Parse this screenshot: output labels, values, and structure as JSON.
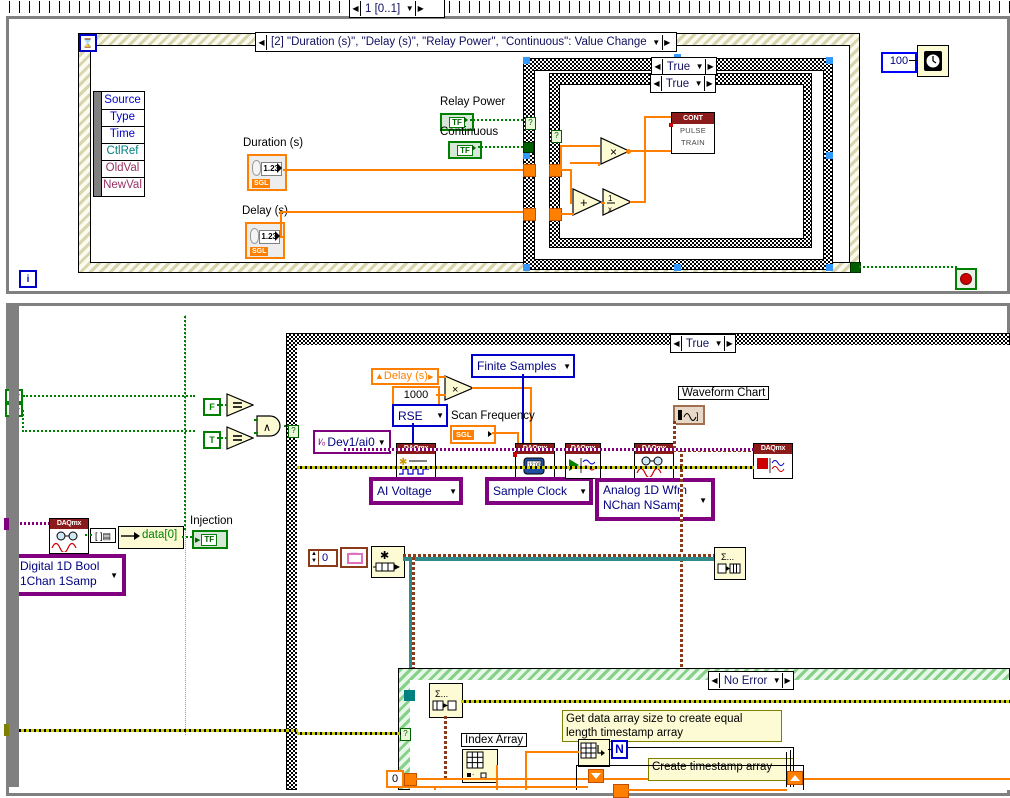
{
  "app": {
    "type": "labview-block-diagram",
    "colors": {
      "wire_orange": "#ff7f00",
      "wire_green": "#008000",
      "wire_purple": "#800080",
      "wire_yellow": "#cccc00",
      "wire_brown": "#8b3a1a",
      "daqmx_header": "#8b1a1a",
      "structure_yellow": "#d8d4ae",
      "structure_green": "#86d08a"
    }
  },
  "upper": {
    "frame_selector": {
      "label": "1 [0..1]",
      "left_arrow": "◀",
      "right_arrow": "▶",
      "down_arrow": "▼"
    },
    "event_structure": {
      "case_label": "[2] \"Duration (s)\", \"Delay (s)\", \"Relay Power\", \"Continuous\": Value Change",
      "timeout_icon": "hourglass-icon",
      "iteration_icon": "i",
      "event_data_node": {
        "rows": [
          "Source",
          "Type",
          "Time",
          "CtlRef",
          "OldVal",
          "NewVal"
        ]
      }
    },
    "controls": [
      {
        "name": "Duration (s)",
        "datatype": "SGL",
        "glyph": "1.23"
      },
      {
        "name": "Delay (s)",
        "datatype": "SGL",
        "glyph": "1.23"
      },
      {
        "name": "Relay Power",
        "datatype": "TF"
      },
      {
        "name": "Continuous",
        "datatype": "TF"
      }
    ],
    "outer_case": {
      "label": "True"
    },
    "inner_case": {
      "label": "True"
    },
    "pulse_train": {
      "header": "CONT",
      "line1": "PULSE",
      "line2": "TRAIN"
    },
    "operators": [
      {
        "name": "multiply",
        "glyph": "×"
      },
      {
        "name": "add",
        "glyph": "+"
      },
      {
        "name": "reciprocal",
        "glyph": "1/x"
      }
    ],
    "wait_ms": {
      "value": "100",
      "icon": "wait-timer-icon"
    },
    "stop_button": {
      "icon": "stop-button-icon"
    }
  },
  "lower": {
    "case_label": "True",
    "no_error_case_label": "No Error",
    "daq_chain": {
      "physical_channel": {
        "value": "Dev1/ai0",
        "icon": "io-channel-icon"
      },
      "create_channel": {
        "vi": "DAQmx Create Channel",
        "selector": "AI Voltage",
        "terminal_config": "RSE"
      },
      "timing": {
        "vi": "DAQmx Timing",
        "selector": "Sample Clock",
        "sample_mode": "Finite Samples"
      },
      "start_task": {
        "vi": "DAQmx Start Task"
      },
      "read": {
        "vi": "DAQmx Read",
        "selector": "Analog 1D Wfm NChan NSamp"
      },
      "clear_task": {
        "vi": "DAQmx Clear Task"
      }
    },
    "labels": {
      "delay_local": "Delay (s)",
      "delay_multiplier": "1000",
      "scan_frequency": "Scan Frequency",
      "scan_frequency_type": "SGL",
      "waveform_chart": "Waveform Chart",
      "index_array": "Index Array",
      "injection": "Injection",
      "digital_read_selector": "Digital 1D Bool 1Chan 1Samp",
      "data_element": "data[0]",
      "zero_constant": "0",
      "zero_constant_2": "0"
    },
    "comments": [
      {
        "text": "Get data array size to create equal\nlength timestamp array"
      },
      {
        "text": "Create timestamp array"
      }
    ],
    "bool_constants": [
      {
        "label": "F"
      },
      {
        "label": "T"
      }
    ],
    "operators": [
      {
        "name": "equal",
        "glyph": "="
      },
      {
        "name": "equal",
        "glyph": "="
      },
      {
        "name": "and",
        "glyph": "∧"
      },
      {
        "name": "multiply",
        "glyph": "×"
      }
    ],
    "loop_n": {
      "label": "N"
    }
  }
}
